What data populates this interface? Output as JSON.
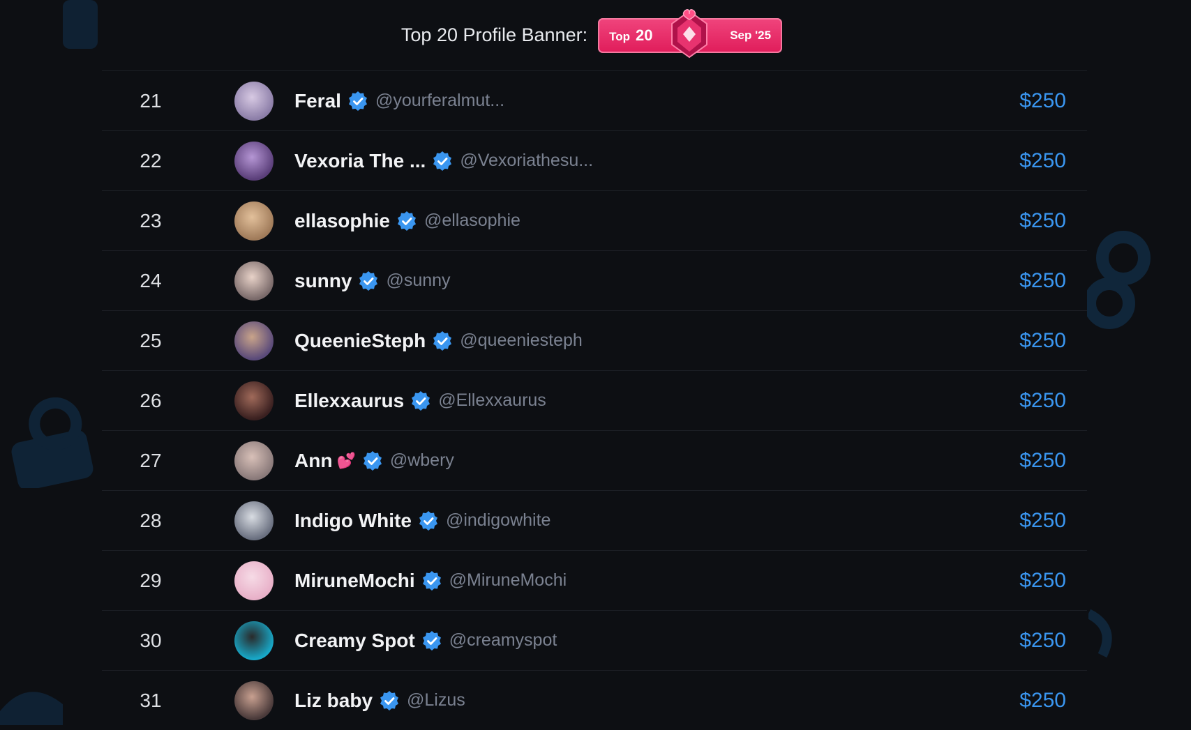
{
  "banner": {
    "label": "Top 20 Profile Banner:",
    "badge_top": "Top",
    "badge_number": "20",
    "badge_date": "Sep '25"
  },
  "colors": {
    "background": "#0d0f13",
    "price": "#3a96f0",
    "verified": "#3a96f0",
    "badge": "#e01c5a"
  },
  "rows": [
    {
      "rank": "21",
      "name": "Feral",
      "emoji": "",
      "handle": "@yourferalmut...",
      "price": "$250"
    },
    {
      "rank": "22",
      "name": "Vexoria The ...",
      "emoji": "",
      "handle": "@Vexoriathesu...",
      "price": "$250"
    },
    {
      "rank": "23",
      "name": "ellasophie",
      "emoji": "",
      "handle": "@ellasophie",
      "price": "$250"
    },
    {
      "rank": "24",
      "name": "sunny",
      "emoji": "",
      "handle": "@sunny",
      "price": "$250"
    },
    {
      "rank": "25",
      "name": "QueenieSteph",
      "emoji": "",
      "handle": "@queeniesteph",
      "price": "$250"
    },
    {
      "rank": "26",
      "name": "Ellexxaurus",
      "emoji": "",
      "handle": "@Ellexxaurus",
      "price": "$250"
    },
    {
      "rank": "27",
      "name": "Ann",
      "emoji": "💕",
      "handle": "@wbery",
      "price": "$250"
    },
    {
      "rank": "28",
      "name": "Indigo White",
      "emoji": "",
      "handle": "@indigowhite",
      "price": "$250"
    },
    {
      "rank": "29",
      "name": "MiruneMochi",
      "emoji": "",
      "handle": "@MiruneMochi",
      "price": "$250"
    },
    {
      "rank": "30",
      "name": "Creamy Spot",
      "emoji": "",
      "handle": "@creamyspot",
      "price": "$250"
    },
    {
      "rank": "31",
      "name": "Liz baby",
      "emoji": "",
      "handle": "@Lizus",
      "price": "$250"
    }
  ]
}
